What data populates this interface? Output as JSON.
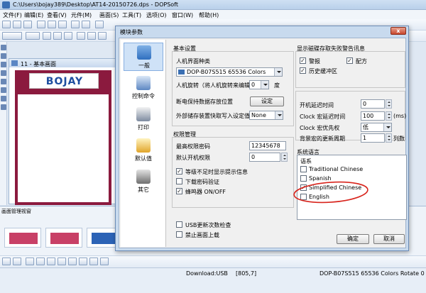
{
  "app": {
    "title": "C:\\Users\\bojay389\\Desktop\\AT14-20150726.dps - DOPSoft",
    "menu": [
      "文件(F)",
      "编辑(E)",
      "查看(V)",
      "元件(M)",
      "画面(S)",
      "工具(T)",
      "选项(O)",
      "窗口(W)",
      "帮助(H)"
    ],
    "subwindow_title": "11 - 基本画面",
    "logo_text": "BOJAY",
    "bottom_panel_title": "画面管理视窗",
    "status": {
      "download": "Download:USB",
      "coords": "[805,7]",
      "model": "DOP-B07S515 65536 Colors Rotate 0"
    }
  },
  "dialog": {
    "title": "模块参数",
    "close_label": "x",
    "nav": [
      {
        "label": "一般",
        "icon": "general-icon",
        "selected": true
      },
      {
        "label": "控制命令",
        "icon": "control-command-icon",
        "selected": false
      },
      {
        "label": "打印",
        "icon": "printer-icon",
        "selected": false
      },
      {
        "label": "默认值",
        "icon": "default-value-icon",
        "selected": false
      },
      {
        "label": "其它",
        "icon": "tools-icon",
        "selected": false
      }
    ],
    "basic": {
      "title": "基本设置",
      "hmi_type_label": "人机界面种类",
      "hmi_type_value": "DOP-B07S515 65536 Colors",
      "rotation_label": "人机旋转（将人机旋转来编辑",
      "rotation_value": "0",
      "rotation_unit": "度",
      "power_hold_label": "断电保持数据存放位置",
      "setting_button": "设定",
      "external_storage_label": "外部储存装置快取写入设定值",
      "external_storage_value": "None"
    },
    "permission": {
      "title": "权限管理",
      "highest_password_label": "最高权限密码",
      "highest_password_value": "12345678",
      "default_permission_label": "默认开机权限",
      "default_permission_value": "0",
      "insufficient_prompt": {
        "label": "等级不足时显示提示信息",
        "checked": true
      },
      "download_password": {
        "label": "下载密码验证",
        "checked": false
      },
      "buzzer": {
        "label": "蜂鸣器 ON/OFF",
        "checked": true
      },
      "usb_update_check": {
        "label": "USB更新次数检查",
        "checked": false
      },
      "disable_upload": {
        "label": "禁止画面上载",
        "checked": false
      }
    },
    "display": {
      "title": "显示磁碟存取失败警告讯息",
      "alarm": {
        "label": "警报",
        "checked": true
      },
      "recipe": {
        "label": "配方",
        "checked": true
      },
      "history_buffer": {
        "label": "历史缓冲区",
        "checked": true
      }
    },
    "timing": {
      "startup_delay_label": "开机延迟时间",
      "startup_delay_value": "0",
      "clock_macro_delay_label": "Clock 宏延迟时间",
      "clock_macro_delay_value": "100",
      "clock_macro_delay_unit": "(ms)",
      "clock_macro_priority_label": "Clock 宏优先权",
      "clock_macro_priority_value": "低",
      "background_macro_label": "背景宏的更新周期",
      "background_macro_value": "1",
      "background_macro_unit": "列数"
    },
    "language": {
      "title": "系统语言",
      "header": "语系",
      "items": [
        {
          "label": "Traditional Chinese",
          "checked": false
        },
        {
          "label": "Spanish",
          "checked": false
        },
        {
          "label": "Simplified Chinese",
          "checked": true
        },
        {
          "label": "English",
          "checked": false
        }
      ]
    },
    "ok_label": "确定",
    "cancel_label": "取消"
  },
  "colors": {
    "canvas_maroon": "#8b1a3e",
    "annotation_red": "#d8241c",
    "selection_blue": "#cfe2f7"
  }
}
